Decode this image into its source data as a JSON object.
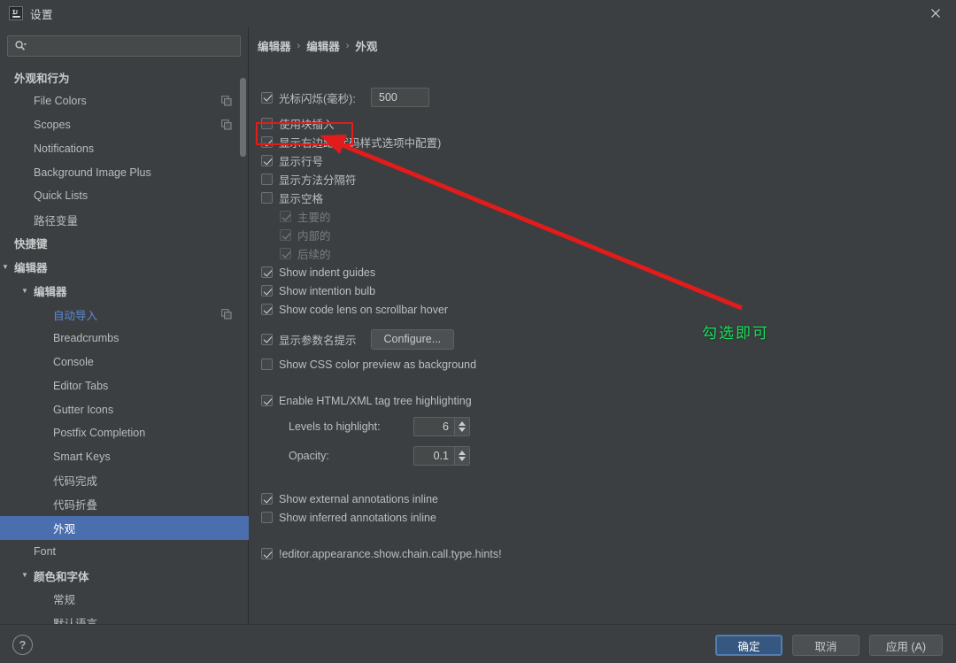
{
  "window": {
    "title": "设置",
    "logo_icon": "intellij-idea-logo-icon",
    "close_icon": "close-icon"
  },
  "sidebar": {
    "search": {
      "placeholder": "",
      "value": "",
      "icon": "search-icon",
      "dropdown_icon": "chevron-down-icon"
    },
    "items": [
      {
        "label": "外观和行为",
        "level": 0,
        "group": true,
        "expanded": null,
        "copy": false,
        "selected": false,
        "modified": false
      },
      {
        "label": "File Colors",
        "level": 1,
        "group": false,
        "expanded": null,
        "copy": true,
        "selected": false,
        "modified": false
      },
      {
        "label": "Scopes",
        "level": 1,
        "group": false,
        "expanded": null,
        "copy": true,
        "selected": false,
        "modified": false
      },
      {
        "label": "Notifications",
        "level": 1,
        "group": false,
        "expanded": null,
        "copy": false,
        "selected": false,
        "modified": false
      },
      {
        "label": "Background Image Plus",
        "level": 1,
        "group": false,
        "expanded": null,
        "copy": false,
        "selected": false,
        "modified": false
      },
      {
        "label": "Quick Lists",
        "level": 1,
        "group": false,
        "expanded": null,
        "copy": false,
        "selected": false,
        "modified": false
      },
      {
        "label": "路径变量",
        "level": 1,
        "group": false,
        "expanded": null,
        "copy": false,
        "selected": false,
        "modified": false
      },
      {
        "label": "快捷键",
        "level": 0,
        "group": true,
        "expanded": null,
        "copy": false,
        "selected": false,
        "modified": false
      },
      {
        "label": "编辑器",
        "level": 0,
        "group": true,
        "expanded": true,
        "copy": false,
        "selected": false,
        "modified": false
      },
      {
        "label": "编辑器",
        "level": 1,
        "group": true,
        "expanded": true,
        "copy": false,
        "selected": false,
        "modified": false
      },
      {
        "label": "自动导入",
        "level": 2,
        "group": false,
        "expanded": null,
        "copy": true,
        "selected": false,
        "modified": true
      },
      {
        "label": "Breadcrumbs",
        "level": 2,
        "group": false,
        "expanded": null,
        "copy": false,
        "selected": false,
        "modified": false
      },
      {
        "label": "Console",
        "level": 2,
        "group": false,
        "expanded": null,
        "copy": false,
        "selected": false,
        "modified": false
      },
      {
        "label": "Editor Tabs",
        "level": 2,
        "group": false,
        "expanded": null,
        "copy": false,
        "selected": false,
        "modified": false
      },
      {
        "label": "Gutter Icons",
        "level": 2,
        "group": false,
        "expanded": null,
        "copy": false,
        "selected": false,
        "modified": false
      },
      {
        "label": "Postfix Completion",
        "level": 2,
        "group": false,
        "expanded": null,
        "copy": false,
        "selected": false,
        "modified": false
      },
      {
        "label": "Smart Keys",
        "level": 2,
        "group": false,
        "expanded": null,
        "copy": false,
        "selected": false,
        "modified": false
      },
      {
        "label": "代码完成",
        "level": 2,
        "group": false,
        "expanded": null,
        "copy": false,
        "selected": false,
        "modified": false
      },
      {
        "label": "代码折叠",
        "level": 2,
        "group": false,
        "expanded": null,
        "copy": false,
        "selected": false,
        "modified": false
      },
      {
        "label": "外观",
        "level": 2,
        "group": false,
        "expanded": null,
        "copy": false,
        "selected": true,
        "modified": false
      },
      {
        "label": "Font",
        "level": 1,
        "group": false,
        "expanded": null,
        "copy": false,
        "selected": false,
        "modified": false
      },
      {
        "label": "颜色和字体",
        "level": 1,
        "group": true,
        "expanded": true,
        "copy": false,
        "selected": false,
        "modified": false
      },
      {
        "label": "常规",
        "level": 2,
        "group": false,
        "expanded": null,
        "copy": false,
        "selected": false,
        "modified": false
      },
      {
        "label": "默认语言",
        "level": 2,
        "group": false,
        "expanded": null,
        "copy": false,
        "selected": false,
        "modified": false
      }
    ]
  },
  "main": {
    "breadcrumb": [
      "编辑器",
      "编辑器",
      "外观"
    ],
    "breadcrumb_separator": "›",
    "options": {
      "caret_blinking": {
        "label": "光标闪烁(毫秒):",
        "checked": true,
        "value": "500"
      },
      "block_caret": {
        "label": "使用块插入",
        "checked": false
      },
      "right_margin": {
        "label": "显示右边距(代码样式选项中配置)",
        "checked": true
      },
      "line_numbers": {
        "label": "显示行号",
        "checked": true
      },
      "method_separators": {
        "label": "显示方法分隔符",
        "checked": false
      },
      "whitespaces": {
        "label": "显示空格",
        "checked": false
      },
      "ws_leading": {
        "label": "主要的",
        "checked": true,
        "disabled": true
      },
      "ws_inner": {
        "label": "内部的",
        "checked": true,
        "disabled": true
      },
      "ws_trailing": {
        "label": "后续的",
        "checked": true,
        "disabled": true
      },
      "indent_guides": {
        "label": "Show indent guides",
        "checked": true
      },
      "intention_bulb": {
        "label": "Show intention bulb",
        "checked": true
      },
      "code_lens": {
        "label": "Show code lens on scrollbar hover",
        "checked": true
      },
      "param_hints": {
        "label": "显示参数名提示",
        "checked": true,
        "button": "Configure..."
      },
      "css_color_preview": {
        "label": "Show CSS color preview as background",
        "checked": false
      },
      "tag_tree_highlighting": {
        "label": "Enable HTML/XML tag tree highlighting",
        "checked": true
      },
      "levels_to_highlight": {
        "label": "Levels to highlight:",
        "value": "6"
      },
      "opacity": {
        "label": "Opacity:",
        "value": "0.1"
      },
      "external_annotations": {
        "label": "Show external annotations inline",
        "checked": true
      },
      "inferred_annotations": {
        "label": "Show inferred annotations inline",
        "checked": false
      },
      "chain_call_hints": {
        "label": "!editor.appearance.show.chain.call.type.hints!",
        "checked": true
      }
    }
  },
  "annotations": {
    "highlight_rect_color": "#e21b1b",
    "arrow_color": "#e21b1b",
    "note_text": "勾选即可",
    "note_color": "#16e05a"
  },
  "footer": {
    "help_label": "?",
    "ok_label": "确定",
    "cancel_label": "取消",
    "apply_label": "应用 (A)"
  }
}
